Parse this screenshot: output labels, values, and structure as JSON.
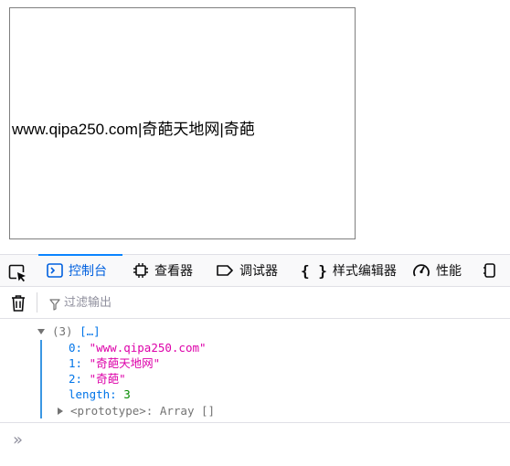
{
  "preview": {
    "text": "www.qipa250.com|奇葩天地网|奇葩"
  },
  "toolbar": {
    "tabs": [
      {
        "label": "控制台",
        "icon": "console-icon",
        "selected": true
      },
      {
        "label": "查看器",
        "icon": "inspector-icon",
        "selected": false
      },
      {
        "label": "调试器",
        "icon": "debugger-icon",
        "selected": false
      },
      {
        "label": "样式编辑器",
        "icon": "style-editor-icon",
        "selected": false
      },
      {
        "label": "性能",
        "icon": "performance-icon",
        "selected": false
      }
    ]
  },
  "filter": {
    "placeholder": "过滤输出"
  },
  "console": {
    "array_summary_count": "(3)",
    "array_summary_preview": "[…]",
    "items": [
      {
        "key": "0:",
        "value": "\"www.qipa250.com\""
      },
      {
        "key": "1:",
        "value": "\"奇葩天地网\""
      },
      {
        "key": "2:",
        "value": "\"奇葩\""
      }
    ],
    "length_key": "length:",
    "length_value": "3",
    "prototype_key": "<prototype>:",
    "prototype_value": "Array []"
  },
  "input": {
    "prompt": "»"
  },
  "colors": {
    "selected_tab": "#0060df",
    "string": "#dd00a9",
    "number": "#058b00",
    "key": "#0074e8",
    "group_line": "#3b97e3"
  }
}
